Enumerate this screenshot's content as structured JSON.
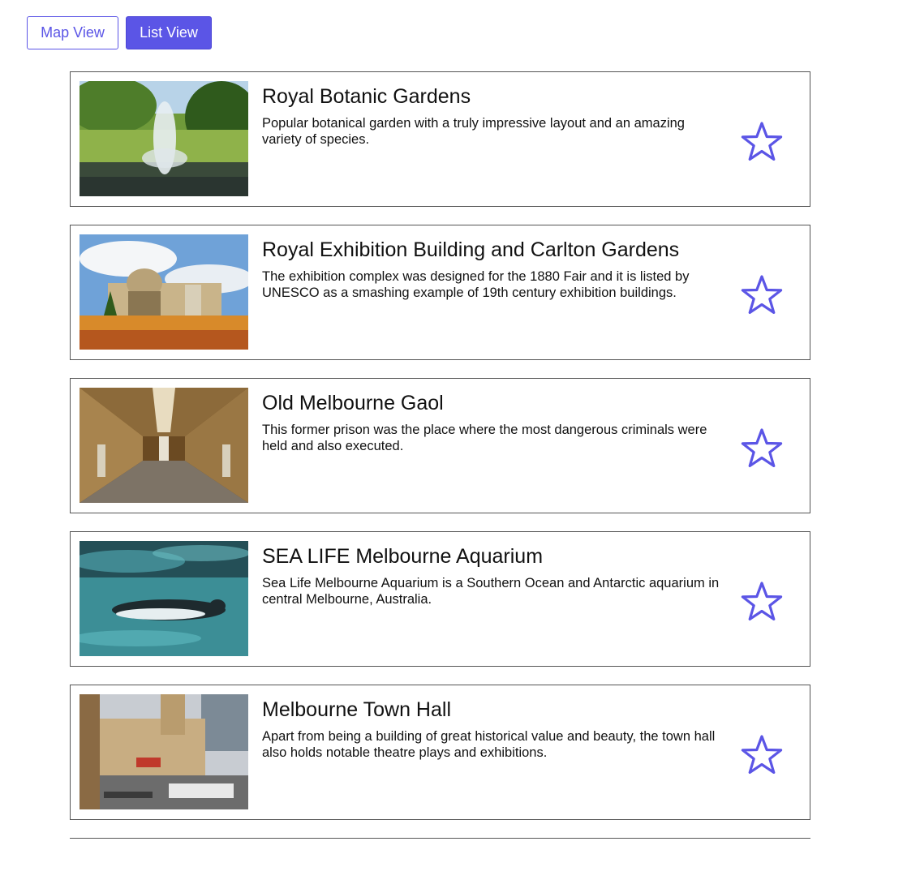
{
  "toolbar": {
    "map_view_label": "Map View",
    "list_view_label": "List View"
  },
  "colors": {
    "accent": "#5b55e6",
    "border": "#555555"
  },
  "places": [
    {
      "title": "Royal Botanic Gardens",
      "description": "Popular botanical garden with a truly impressive layout and an amazing variety of species.",
      "image": "garden-fountain-photo",
      "favorite": false
    },
    {
      "title": "Royal Exhibition Building and Carlton Gardens",
      "description": "The exhibition complex was designed for the 1880 Fair and it is listed by UNESCO as a smashing example of 19th century exhibition buildings.",
      "image": "exhibition-building-photo",
      "favorite": false
    },
    {
      "title": "Old Melbourne Gaol",
      "description": "This former prison was the place where the most dangerous criminals were held and also executed.",
      "image": "prison-corridor-photo",
      "favorite": false
    },
    {
      "title": "SEA LIFE Melbourne Aquarium",
      "description": "Sea Life Melbourne Aquarium is a Southern Ocean and Antarctic aquarium in central Melbourne, Australia.",
      "image": "penguin-underwater-photo",
      "favorite": false
    },
    {
      "title": "Melbourne Town Hall",
      "description": "Apart from being a building of great historical value and beauty, the town hall also holds notable theatre plays and exhibitions.",
      "image": "town-hall-street-photo",
      "favorite": false
    }
  ]
}
